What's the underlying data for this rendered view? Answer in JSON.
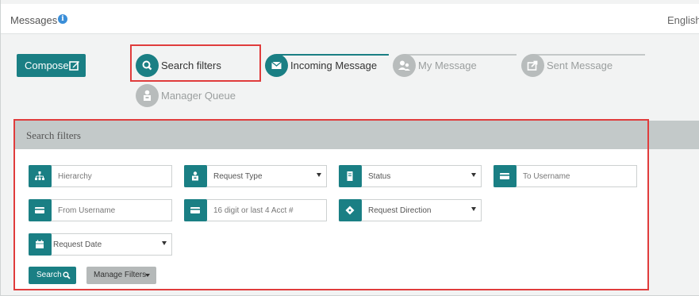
{
  "header": {
    "title": "Messages",
    "language": "English"
  },
  "toolbar": {
    "compose_label": "Compose"
  },
  "steps": [
    {
      "label": "Search filters",
      "active": true
    },
    {
      "label": "Incoming Message",
      "active": true
    },
    {
      "label": "My Message",
      "active": false
    },
    {
      "label": "Sent Message",
      "active": false
    },
    {
      "label": "Manager Queue",
      "active": false
    }
  ],
  "filters_panel": {
    "title": "Search filters",
    "fields": {
      "hierarchy": "Hierarchy",
      "request_type": "Request Type",
      "status": "Status",
      "to_username": "To Username",
      "from_username": "From Username",
      "acct": "16 digit or last 4 Acct #",
      "request_direction": "Request Direction",
      "request_date": "Request Date"
    },
    "search_label": "Search",
    "manage_label": "Manage Filters"
  },
  "colors": {
    "accent": "#1a7f84",
    "highlight": "#e03c3c",
    "inactive": "#b8bcbc"
  }
}
